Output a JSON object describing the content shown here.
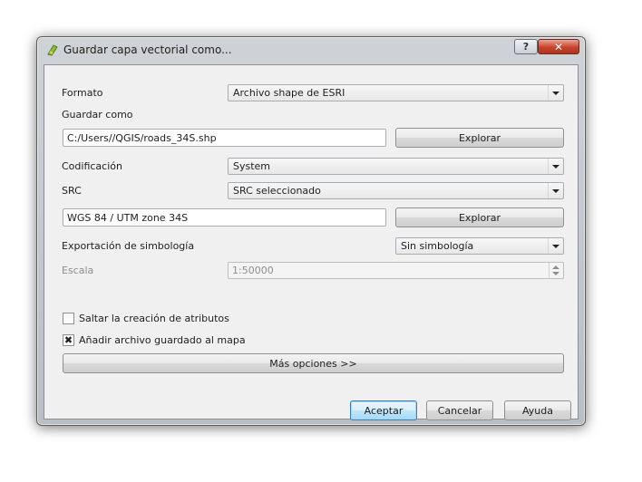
{
  "window": {
    "title": "Guardar capa vectorial como...",
    "help_button": "?",
    "close_button": "✕"
  },
  "form": {
    "format_label": "Formato",
    "format_value": "Archivo shape de ESRI",
    "save_as_label": "Guardar como",
    "save_as_value": "C:/Users//QGIS/roads_34S.shp",
    "browse_label": "Explorar",
    "encoding_label": "Codificación",
    "encoding_value": "System",
    "crs_label": "SRC",
    "crs_value": "SRC seleccionado",
    "crs_text": "WGS 84 / UTM zone 34S",
    "crs_browse_label": "Explorar",
    "symbology_label": "Exportación de simbología",
    "symbology_value": "Sin simbología",
    "scale_label": "Escala",
    "scale_value": "1:50000",
    "skip_attributes_label": "Saltar la creación de atributos",
    "skip_attributes_checked": false,
    "add_to_map_label": "Añadir archivo guardado al mapa",
    "add_to_map_checked": true,
    "add_to_map_mark": "✖",
    "more_options_label": "Más opciones >>"
  },
  "footer": {
    "accept_label": "Aceptar",
    "cancel_label": "Cancelar",
    "help_label": "Ayuda"
  }
}
